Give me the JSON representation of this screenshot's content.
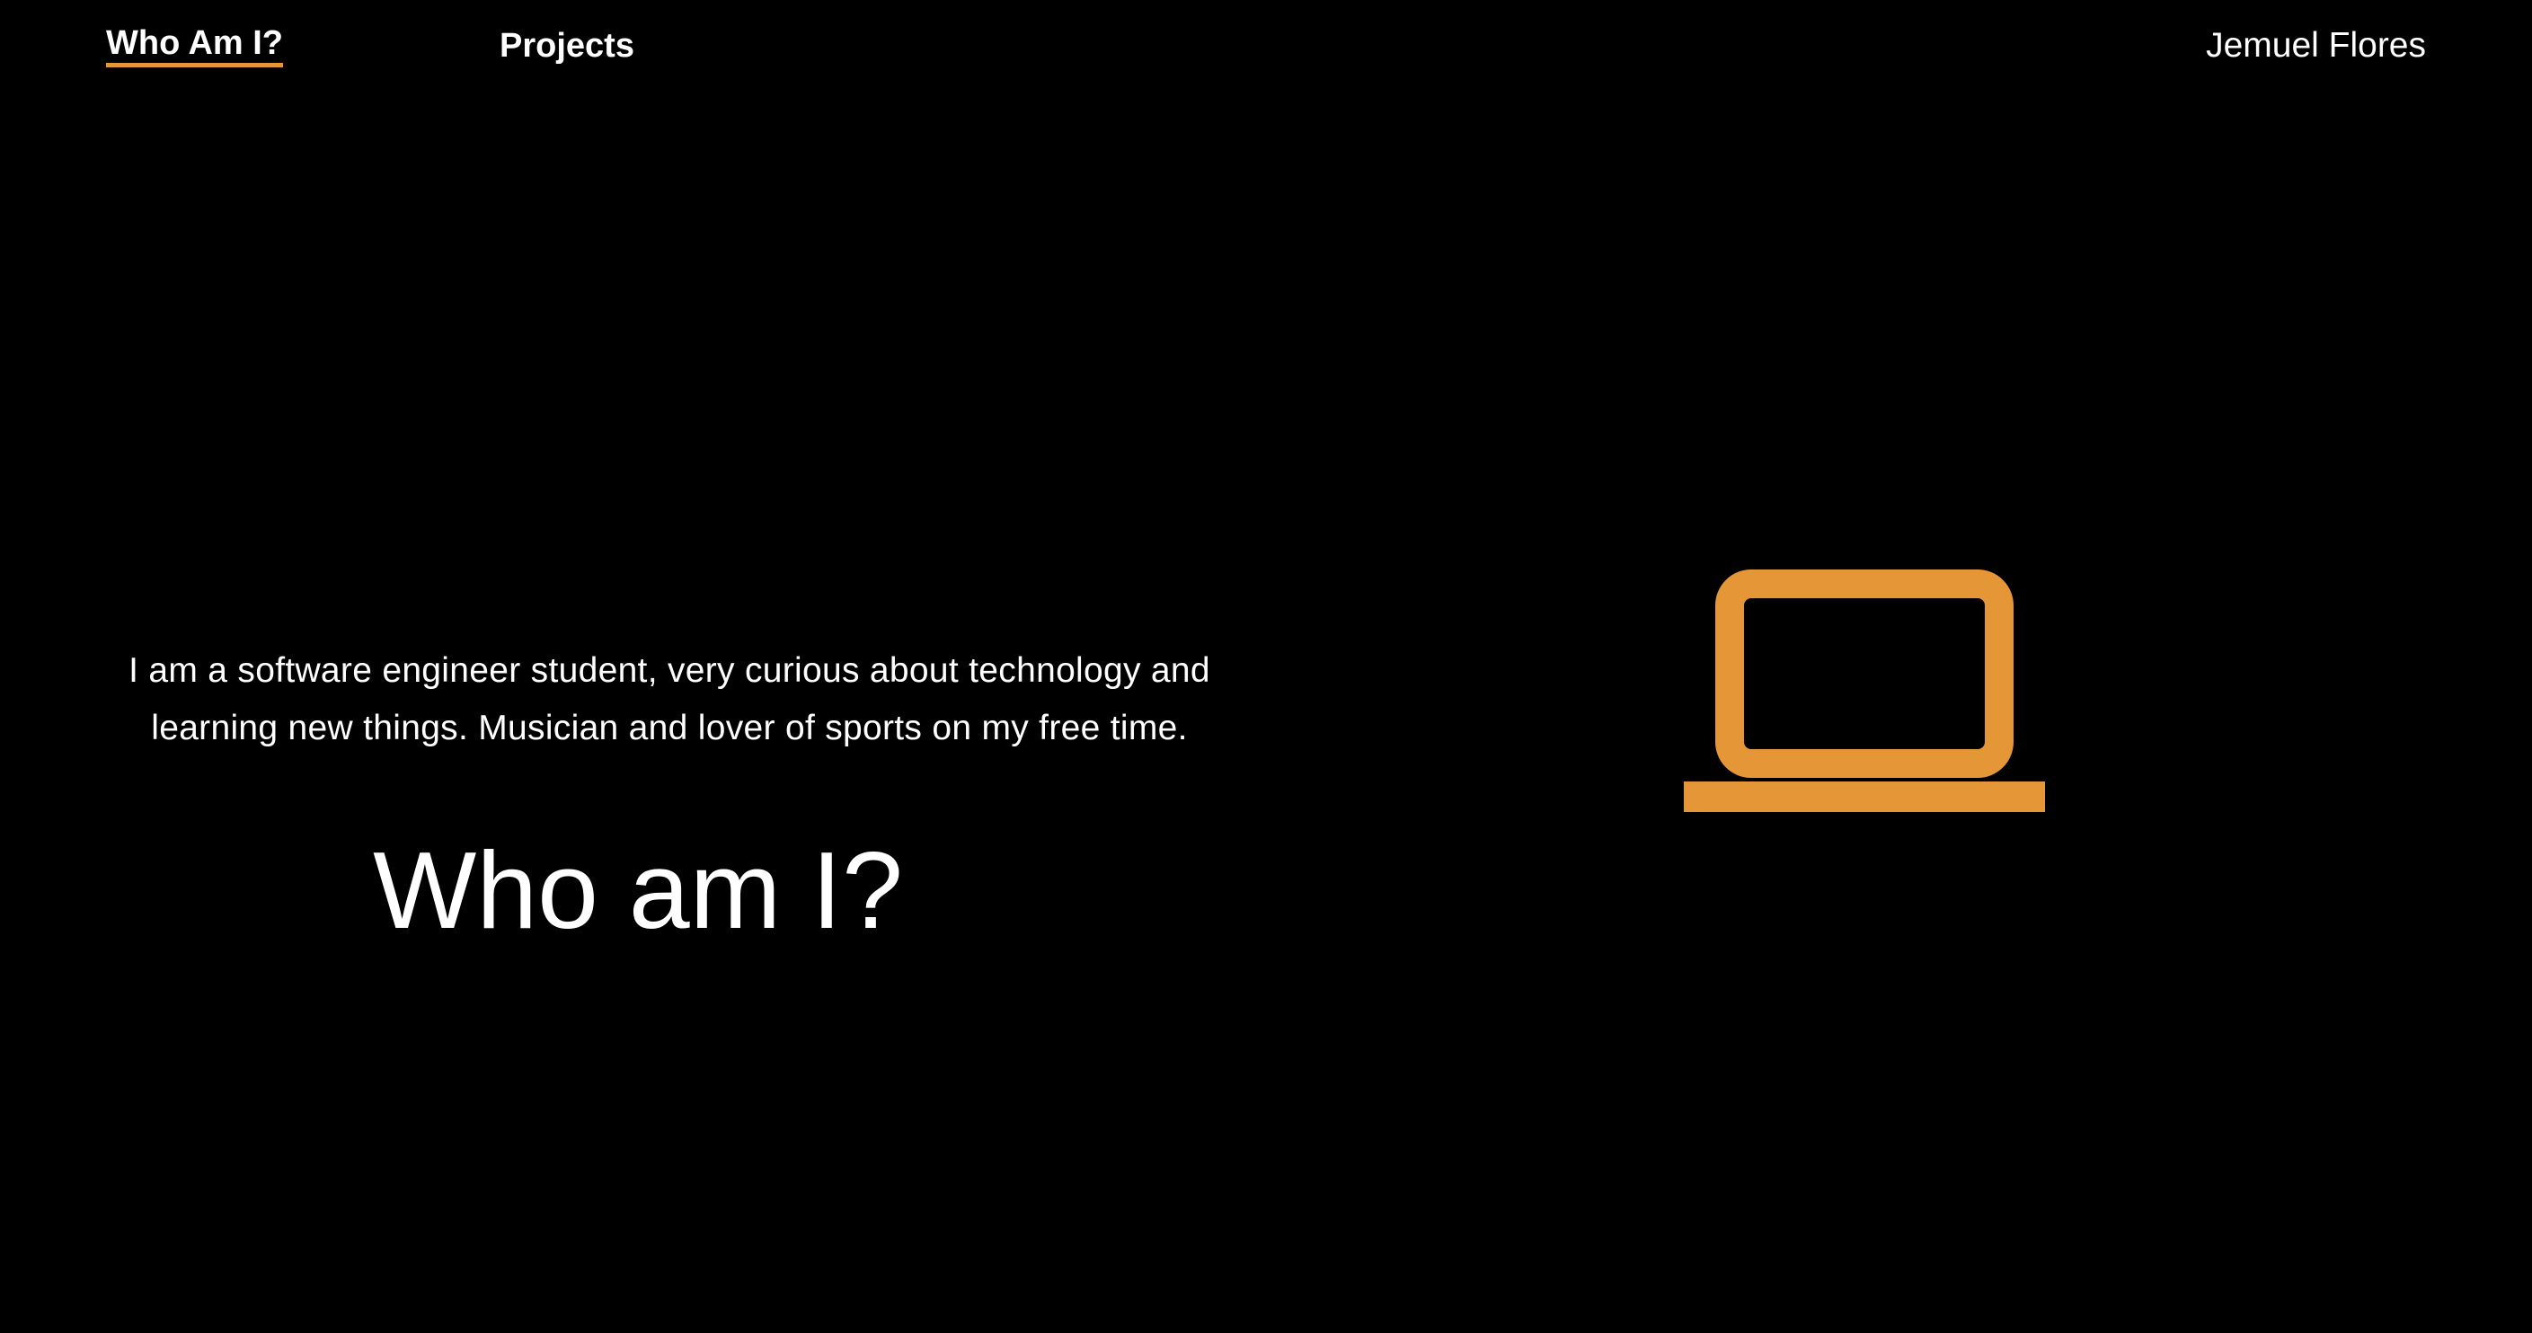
{
  "nav": {
    "items": [
      {
        "label": "Who Am I?",
        "active": true
      },
      {
        "label": "Projects",
        "active": false
      }
    ],
    "brand": "Jemuel Flores"
  },
  "main": {
    "bio": "I am a software engineer student, very curious about technology and learning new things. Musician and lover of sports on my free time.",
    "heading": "Who am I?",
    "illustration_icon": "laptop-icon"
  },
  "colors": {
    "background": "#000000",
    "text": "#ffffff",
    "accent": "#e59637"
  }
}
